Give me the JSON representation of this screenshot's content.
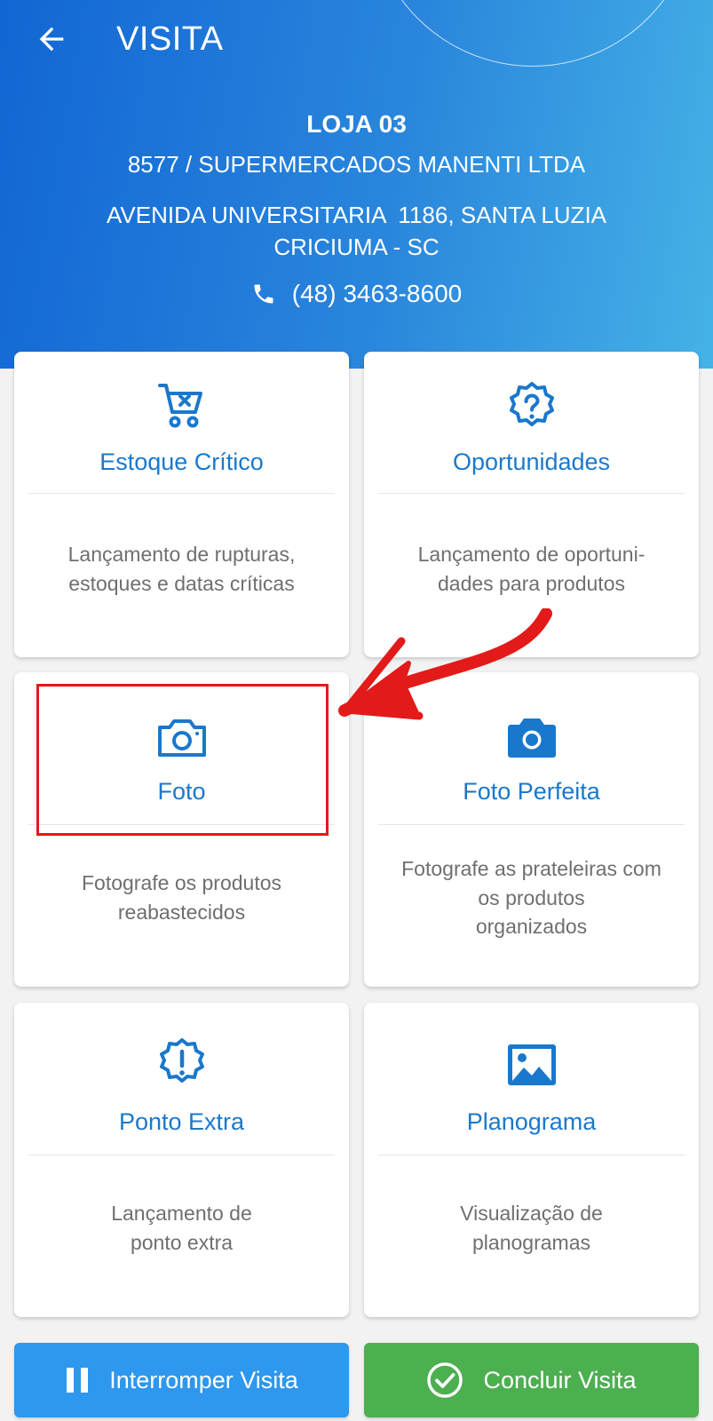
{
  "header": {
    "title": "VISITA",
    "store_name": "LOJA 03",
    "store_company": "8577 / SUPERMERCADOS MANENTI LTDA",
    "address_line1": "AVENIDA UNIVERSITARIA  1186, SANTA LUZIA",
    "address_line2": "CRICIUMA - SC",
    "phone": "(48) 3463-8600",
    "back_icon": "arrow-back-icon",
    "phone_icon": "phone-icon"
  },
  "cards": [
    {
      "title": "Estoque Crítico",
      "desc_line1": "Lançamento de rupturas,",
      "desc_line2": "estoques e datas críticas",
      "icon": "cart-remove-icon"
    },
    {
      "title": "Oportunidades",
      "desc_line1": "Lançamento de oportuni-",
      "desc_line2": "dades para produtos",
      "icon": "question-badge-icon"
    },
    {
      "title": "Foto",
      "desc_line1": "Fotografe os produtos",
      "desc_line2": "reabastecidos",
      "icon": "camera-outline-icon"
    },
    {
      "title": "Foto Perfeita",
      "desc_line1": "Fotografe as prateleiras com",
      "desc_line2": "os produtos",
      "desc_line3": "organizados",
      "icon": "camera-filled-icon"
    },
    {
      "title": "Ponto Extra",
      "desc_line1": "Lançamento de",
      "desc_line2": "ponto extra",
      "icon": "alert-badge-icon"
    },
    {
      "title": "Planograma",
      "desc_line1": "Visualização de",
      "desc_line2": "planogramas",
      "icon": "image-icon"
    }
  ],
  "footer": {
    "pause_label": "Interromper Visita",
    "finish_label": "Concluir Visita",
    "pause_icon": "pause-icon",
    "finish_icon": "check-circle-icon"
  },
  "colors": {
    "accent": "#1a78cc",
    "header_start": "#1266d4",
    "header_end": "#45b2e6",
    "pause_button": "#2e97ee",
    "finish_button": "#4caf50",
    "annotation": "#e31a1a"
  }
}
